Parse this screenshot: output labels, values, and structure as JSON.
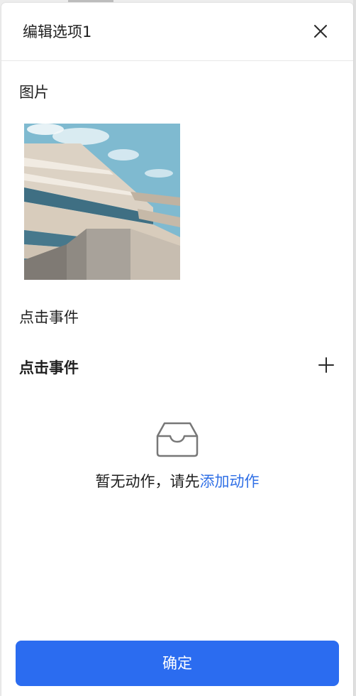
{
  "dialog": {
    "title": "编辑选项1"
  },
  "image_section": {
    "label": "图片",
    "image_alt_icon": "building-photo"
  },
  "click_event": {
    "label": "点击事件",
    "section_title": "点击事件",
    "add_icon": "plus-icon"
  },
  "empty_state": {
    "icon": "empty-inbox-icon",
    "text": "暂无动作，请先",
    "link": "添加动作"
  },
  "footer": {
    "confirm_label": "确定"
  },
  "colors": {
    "primary": "#2b6cf0",
    "link": "#2f6fe6",
    "sky": "#7fbad0"
  }
}
